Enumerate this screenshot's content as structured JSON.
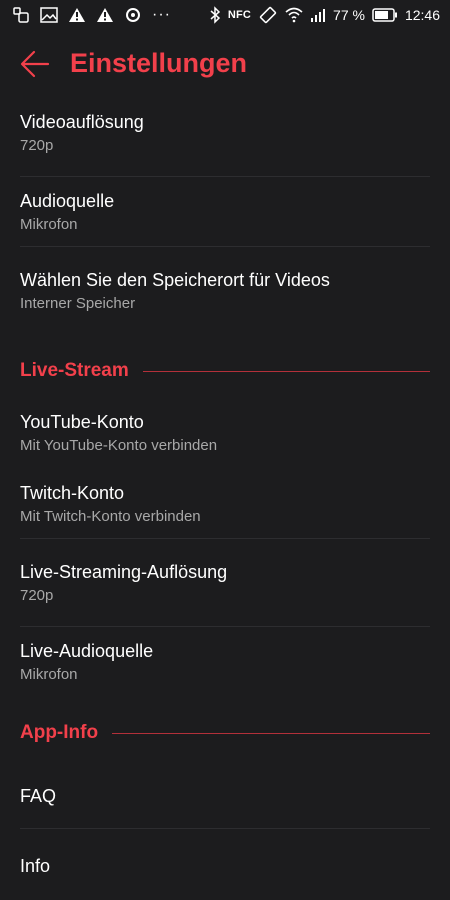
{
  "status_bar": {
    "icons_left": [
      "screen-record-icon",
      "image-icon",
      "warning-icon",
      "warning-icon",
      "sync-icon",
      "more-dots-icon"
    ],
    "more": "···",
    "nfc": "NFC",
    "battery_percent": "77 %",
    "time": "12:46"
  },
  "app_bar": {
    "back_icon": "arrow-left-icon",
    "title": "Einstellungen",
    "accent_color": "#f2404b"
  },
  "settings": [
    {
      "title": "Videoauflösung",
      "subtitle": "720p"
    },
    {
      "title": "Audioquelle",
      "subtitle": "Mikrofon"
    },
    {
      "title": "Wählen Sie den Speicherort für Videos",
      "subtitle": "Interner Speicher"
    }
  ],
  "sections": {
    "live_stream": "Live-Stream",
    "app_info": "App-Info"
  },
  "live_settings": [
    {
      "title": "YouTube-Konto",
      "subtitle": "Mit YouTube-Konto verbinden"
    },
    {
      "title": "Twitch-Konto",
      "subtitle": "Mit Twitch-Konto verbinden"
    },
    {
      "title": "Live-Streaming-Auflösung",
      "subtitle": "720p"
    },
    {
      "title": "Live-Audioquelle",
      "subtitle": "Mikrofon"
    }
  ],
  "app_info_items": [
    {
      "title": "FAQ"
    },
    {
      "title": "Info"
    }
  ]
}
